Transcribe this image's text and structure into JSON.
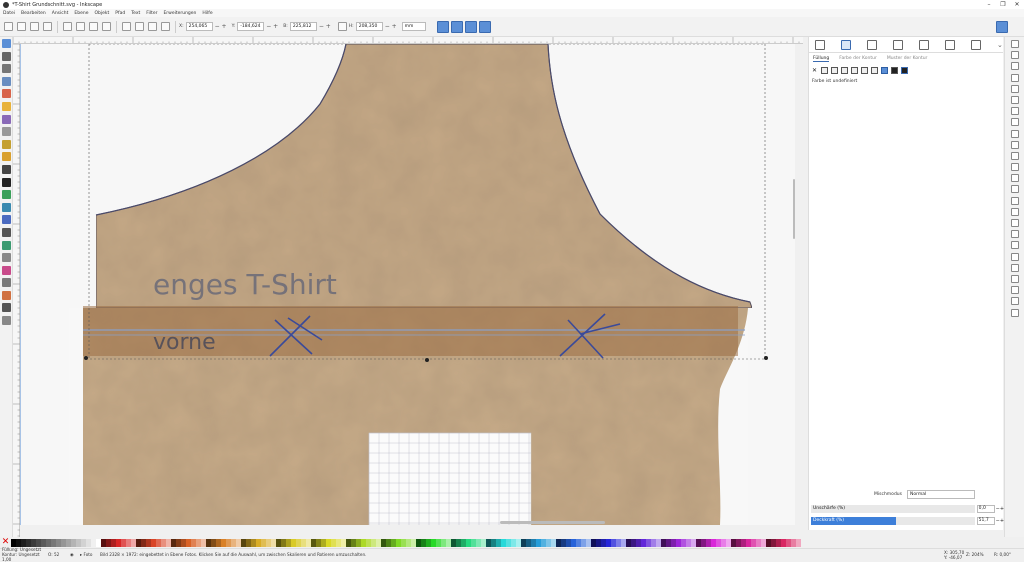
{
  "window": {
    "title": "*T-Shirt Grundschnitt.svg - Inkscape",
    "controls": [
      "–",
      "❐",
      "✕"
    ]
  },
  "menu": [
    "Datei",
    "Bearbeiten",
    "Ansicht",
    "Ebene",
    "Objekt",
    "Pfad",
    "Text",
    "Filter",
    "Erweiterungen",
    "Hilfe"
  ],
  "toolbar": {
    "x_label": "X:",
    "x_value": "254,065",
    "y_label": "Y:",
    "y_value": "-184,624",
    "w_label": "B:",
    "w_value": "225,812",
    "h_label": "H:",
    "h_value": "208,350",
    "unit": "mm"
  },
  "canvas": {
    "handwriting_line1": "enges T-Shirt",
    "handwriting_line2": "vorne"
  },
  "fill_panel": {
    "tabs": [
      "Füllung",
      "Farbe der Kontur",
      "Muster der Kontur"
    ],
    "active_tab": "Füllung",
    "message": "Farbe ist undefiniert",
    "blend_label": "Mischmodus",
    "blend_value": "Normal",
    "blur_label": "Unschärfe (%)",
    "blur_value": "0,0",
    "opacity_label": "Deckkraft (%)",
    "opacity_value": "51,7",
    "opacity_fraction": 0.517
  },
  "status": {
    "fill_label": "Füllung:",
    "fill_value": "Ungesetzt",
    "stroke_label": "Kontur:",
    "stroke_value": "Ungesetzt",
    "stroke_width": "1,00",
    "opacity": "52",
    "layer": "Foto",
    "message": "Bild 2328 × 1972: eingebettet in Ebene Fotos. Klicken Sie auf die Auswahl, um zwischen Skalieren und Rotieren umzuschalten.",
    "x_coord": "X: 305,70",
    "y_coord": "Y: -46,07",
    "zoom_label": "Z:",
    "zoom_value": "204%",
    "rotation_label": "R:",
    "rotation_value": "0,00°"
  },
  "colors": {
    "accent": "#3d7fd9",
    "paper": "#c4a886"
  }
}
